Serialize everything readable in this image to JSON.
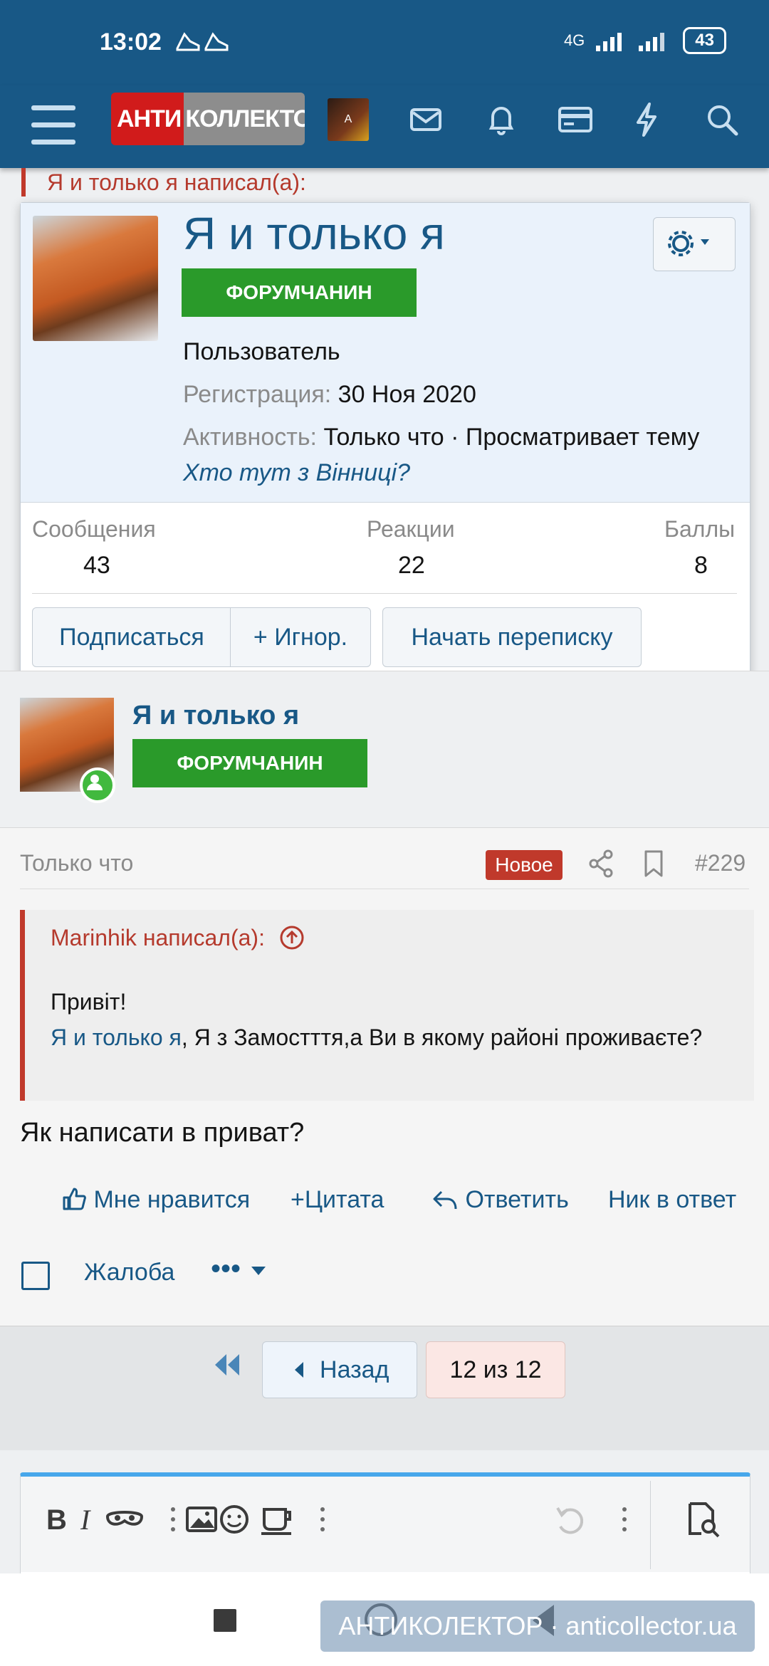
{
  "status": {
    "time": "13:02",
    "network": "4G",
    "battery": "43"
  },
  "header": {
    "logo_part1": "АНТИ",
    "logo_part2": "КОЛЛЕКТОР",
    "mini_avatar_text": "A"
  },
  "quote_top": {
    "text": "Я и только я написал(а):"
  },
  "card": {
    "name": "Я и только я",
    "badge": "ФОРУМЧАНИН",
    "role": "Пользователь",
    "reg_label": "Регистрация:",
    "reg_value": "30 Ноя 2020",
    "activity_label": "Активность:",
    "activity_value": "Только что · Просматривает тему",
    "thread_link": "Хто тут з Вінниці?",
    "stats": [
      {
        "label": "Сообщения",
        "value": "43"
      },
      {
        "label": "Реакции",
        "value": "22"
      },
      {
        "label": "Баллы",
        "value": "8"
      }
    ],
    "buttons": {
      "follow": "Подписаться",
      "ignore": "+ Игнор.",
      "message": "Начать переписку"
    }
  },
  "post": {
    "user_name": "Я и только я",
    "badge": "ФОРУМЧАНИН",
    "time": "Только что",
    "new_label": "Новое",
    "number": "#229",
    "quote_head": "Marinhik написал(а):",
    "quote_line1": "Привіт!",
    "quote_mention": "Я и только я",
    "quote_rest": ", Я з Замостття,а Ви в якому районі проживаєте?",
    "text": "Як написати в приват?",
    "actions": {
      "like": "Мне нравится",
      "quote": "Цитата",
      "reply": "Ответить",
      "nick": "Ник в ответ"
    },
    "report": "Жалоба",
    "more": "•••"
  },
  "pager": {
    "back": "Назад",
    "page": "12 из 12"
  },
  "watermark": "АНТИКОЛЕКТОР · anticollector.ua",
  "colors": {
    "header": "#185886",
    "accent_red": "#c0392b",
    "badge_green": "#2a9a2a",
    "link_blue": "#185886"
  }
}
